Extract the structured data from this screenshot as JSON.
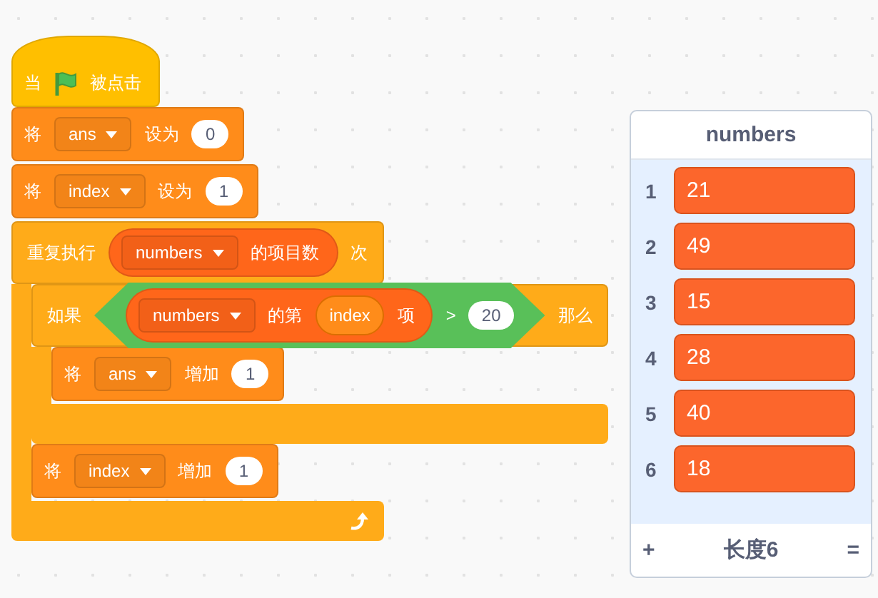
{
  "script": [
    {
      "kind": "hat",
      "color": "#ffbf00",
      "parts": [
        {
          "kind": "label",
          "text": "当"
        },
        {
          "kind": "flag"
        },
        {
          "kind": "label",
          "text": "被点击"
        }
      ]
    },
    {
      "kind": "stack",
      "color": "#ff8c1a",
      "parts": [
        {
          "kind": "label",
          "text": "将"
        },
        {
          "kind": "dropdown",
          "text": "ans"
        },
        {
          "kind": "label",
          "text": "设为"
        },
        {
          "kind": "number",
          "text": "0"
        }
      ]
    },
    {
      "kind": "stack",
      "color": "#ff8c1a",
      "parts": [
        {
          "kind": "label",
          "text": "将"
        },
        {
          "kind": "dropdown",
          "text": "index"
        },
        {
          "kind": "label",
          "text": "设为"
        },
        {
          "kind": "number",
          "text": "1"
        }
      ]
    },
    {
      "kind": "repeat",
      "color": "#ffab19",
      "parts": [
        {
          "kind": "label",
          "text": "重复执行"
        },
        {
          "kind": "reporter",
          "color": "#ff661a",
          "parts": [
            {
              "kind": "dropdown",
              "text": "numbers"
            },
            {
              "kind": "label",
              "text": "的项目数"
            }
          ]
        },
        {
          "kind": "label",
          "text": "次"
        }
      ],
      "children": [
        {
          "kind": "if",
          "color": "#ffab19",
          "parts": [
            {
              "kind": "label",
              "text": "如果"
            },
            {
              "kind": "boolean",
              "color": "#59c059",
              "parts": [
                {
                  "kind": "reporter",
                  "color": "#ff661a",
                  "parts": [
                    {
                      "kind": "dropdown",
                      "text": "numbers"
                    },
                    {
                      "kind": "label",
                      "text": "的第"
                    },
                    {
                      "kind": "variable",
                      "text": "index"
                    },
                    {
                      "kind": "label",
                      "text": "项"
                    }
                  ]
                },
                {
                  "kind": "label",
                  "text": ">"
                },
                {
                  "kind": "number",
                  "text": "20"
                }
              ]
            },
            {
              "kind": "label",
              "text": "那么"
            }
          ],
          "children": [
            {
              "kind": "stack",
              "color": "#ff8c1a",
              "parts": [
                {
                  "kind": "label",
                  "text": "将"
                },
                {
                  "kind": "dropdown",
                  "text": "ans"
                },
                {
                  "kind": "label",
                  "text": "增加"
                },
                {
                  "kind": "number",
                  "text": "1"
                }
              ]
            }
          ]
        },
        {
          "kind": "stack",
          "color": "#ff8c1a",
          "parts": [
            {
              "kind": "label",
              "text": "将"
            },
            {
              "kind": "dropdown",
              "text": "index"
            },
            {
              "kind": "label",
              "text": "增加"
            },
            {
              "kind": "number",
              "text": "1"
            }
          ]
        }
      ]
    }
  ],
  "list_monitor": {
    "title": "numbers",
    "items": [
      {
        "index": "1",
        "value": "21"
      },
      {
        "index": "2",
        "value": "49"
      },
      {
        "index": "3",
        "value": "15"
      },
      {
        "index": "4",
        "value": "28"
      },
      {
        "index": "5",
        "value": "40"
      },
      {
        "index": "6",
        "value": "18"
      }
    ],
    "add_button": "+",
    "length_label": "长度6",
    "resize_handle": "="
  }
}
